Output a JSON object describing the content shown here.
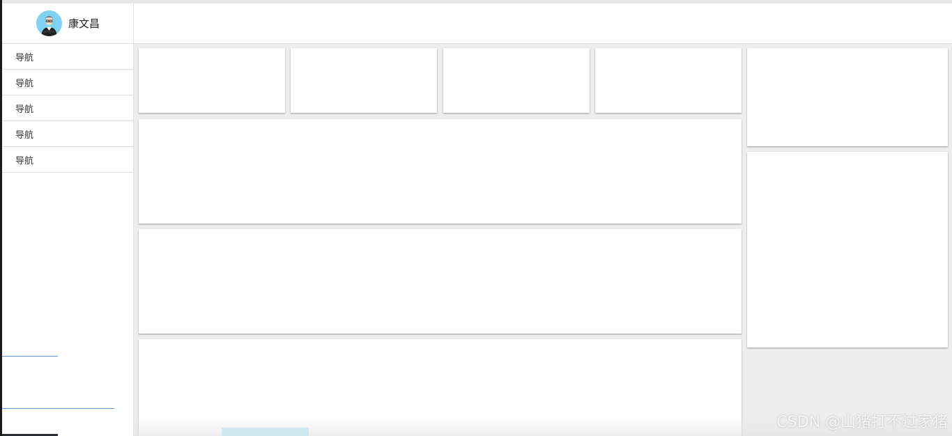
{
  "header": {
    "user_name": "康文昌",
    "avatar_icon": "user-avatar-icon"
  },
  "sidebar": {
    "items": [
      {
        "label": "导航"
      },
      {
        "label": "导航"
      },
      {
        "label": "导航"
      },
      {
        "label": "导航"
      },
      {
        "label": "导航"
      }
    ]
  },
  "watermark": {
    "text": "CSDN @山猪打不过家猪"
  },
  "colors": {
    "background": "#eeedee",
    "card": "#ffffff",
    "avatar_bg": "#7fd2f2",
    "link_line": "#5d95d9"
  }
}
